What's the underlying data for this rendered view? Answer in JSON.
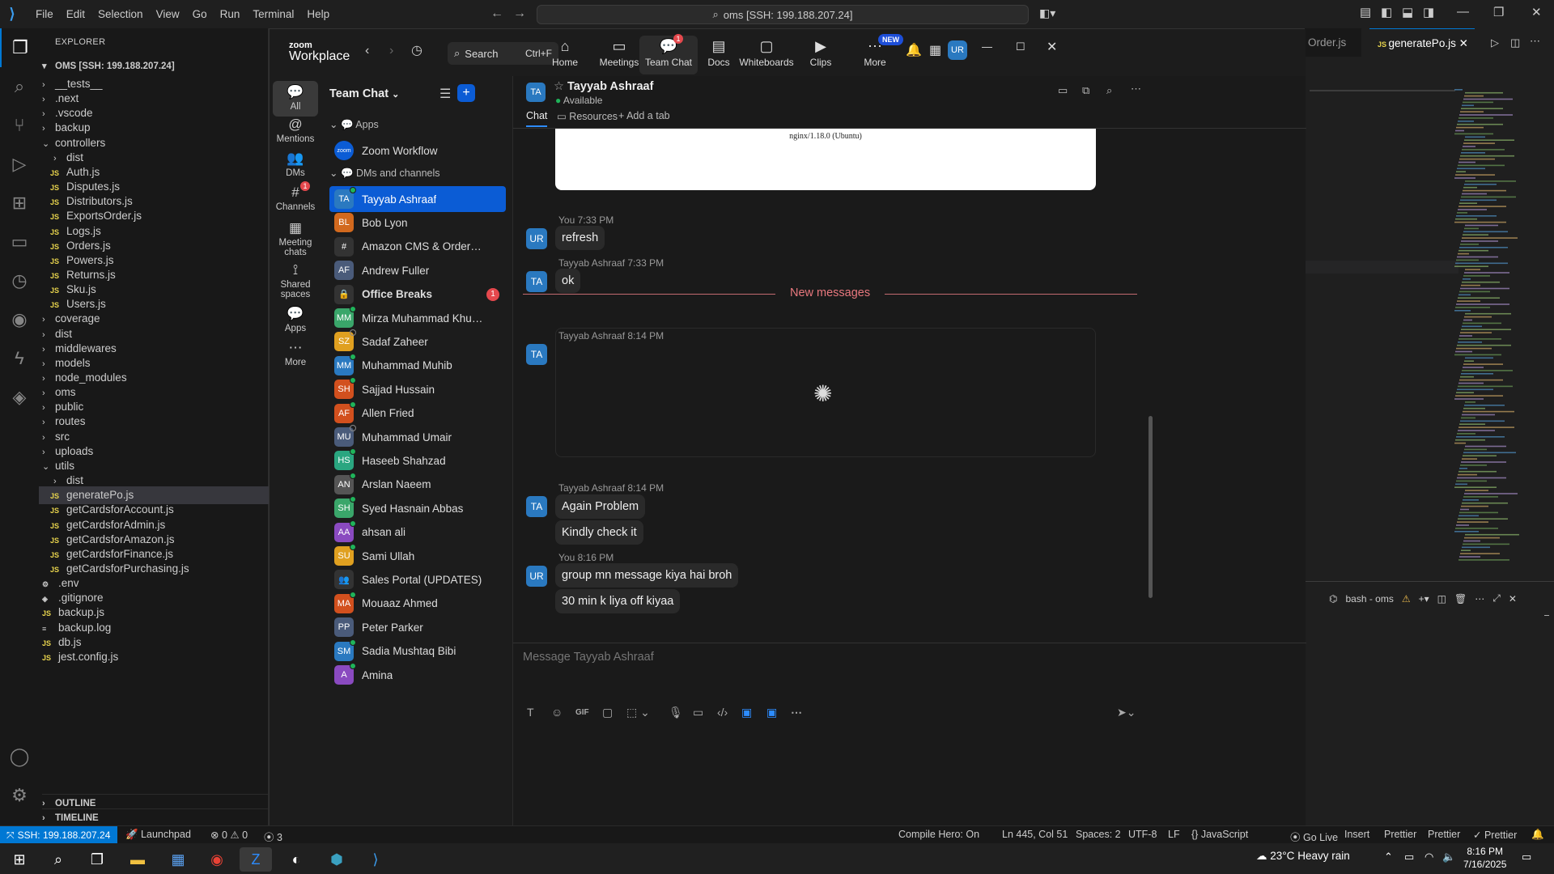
{
  "vscode": {
    "menu": [
      "File",
      "Edit",
      "Selection",
      "View",
      "Go",
      "Run",
      "Terminal",
      "Help"
    ],
    "search": "oms [SSH: 199.188.207.24]",
    "explorer_title": "EXPLORER",
    "root": "OMS [SSH: 199.188.207.24]",
    "tree": [
      {
        "label": "__tests__",
        "type": "folder",
        "open": false,
        "depth": 1
      },
      {
        "label": ".next",
        "type": "folder",
        "open": false,
        "depth": 1
      },
      {
        "label": ".vscode",
        "type": "folder",
        "open": false,
        "depth": 1
      },
      {
        "label": "backup",
        "type": "folder",
        "open": false,
        "depth": 1
      },
      {
        "label": "controllers",
        "type": "folder",
        "open": true,
        "depth": 1
      },
      {
        "label": "dist",
        "type": "folder",
        "open": false,
        "depth": 2
      },
      {
        "label": "Auth.js",
        "type": "js",
        "depth": 2
      },
      {
        "label": "Disputes.js",
        "type": "js",
        "depth": 2
      },
      {
        "label": "Distributors.js",
        "type": "js",
        "depth": 2
      },
      {
        "label": "ExportsOrder.js",
        "type": "js",
        "depth": 2
      },
      {
        "label": "Logs.js",
        "type": "js",
        "depth": 2
      },
      {
        "label": "Orders.js",
        "type": "js",
        "depth": 2
      },
      {
        "label": "Powers.js",
        "type": "js",
        "depth": 2
      },
      {
        "label": "Returns.js",
        "type": "js",
        "depth": 2
      },
      {
        "label": "Sku.js",
        "type": "js",
        "depth": 2
      },
      {
        "label": "Users.js",
        "type": "js",
        "depth": 2
      },
      {
        "label": "coverage",
        "type": "folder",
        "open": false,
        "depth": 1
      },
      {
        "label": "dist",
        "type": "folder",
        "open": false,
        "depth": 1
      },
      {
        "label": "middlewares",
        "type": "folder",
        "open": false,
        "depth": 1
      },
      {
        "label": "models",
        "type": "folder",
        "open": false,
        "depth": 1
      },
      {
        "label": "node_modules",
        "type": "folder",
        "open": false,
        "depth": 1
      },
      {
        "label": "oms",
        "type": "folder",
        "open": false,
        "depth": 1
      },
      {
        "label": "public",
        "type": "folder",
        "open": false,
        "depth": 1
      },
      {
        "label": "routes",
        "type": "folder",
        "open": false,
        "depth": 1
      },
      {
        "label": "src",
        "type": "folder",
        "open": false,
        "depth": 1
      },
      {
        "label": "uploads",
        "type": "folder",
        "open": false,
        "depth": 1
      },
      {
        "label": "utils",
        "type": "folder",
        "open": true,
        "depth": 1
      },
      {
        "label": "dist",
        "type": "folder",
        "open": false,
        "depth": 2
      },
      {
        "label": "generatePo.js",
        "type": "js",
        "depth": 2,
        "selected": true
      },
      {
        "label": "getCardsforAccount.js",
        "type": "js",
        "depth": 2
      },
      {
        "label": "getCardsforAdmin.js",
        "type": "js",
        "depth": 2
      },
      {
        "label": "getCardsforAmazon.js",
        "type": "js",
        "depth": 2
      },
      {
        "label": "getCardsforFinance.js",
        "type": "js",
        "depth": 2
      },
      {
        "label": "getCardsforPurchasing.js",
        "type": "js",
        "depth": 2
      },
      {
        "label": ".env",
        "type": "gear",
        "depth": 1
      },
      {
        "label": ".gitignore",
        "type": "git",
        "depth": 1
      },
      {
        "label": "backup.js",
        "type": "js",
        "depth": 1
      },
      {
        "label": "backup.log",
        "type": "log",
        "depth": 1
      },
      {
        "label": "db.js",
        "type": "js",
        "depth": 1
      },
      {
        "label": "jest.config.js",
        "type": "js",
        "depth": 1
      }
    ],
    "outline": "OUTLINE",
    "timeline": "TIMELINE",
    "tabs": [
      "Order.js",
      "generatePo.js"
    ],
    "terminal": "bash - oms",
    "status": {
      "remote": "SSH: 199.188.207.24",
      "launchpad": "Launchpad",
      "problems": "0",
      "warnings": "0",
      "ports": "3",
      "compile": "Compile Hero: On",
      "position": "Ln 445, Col 51",
      "spaces": "Spaces: 2",
      "encoding": "UTF-8",
      "eol": "LF",
      "language": "JavaScript",
      "golive": "Go Live",
      "insert": "Insert",
      "prettier1": "Prettier",
      "prettier2": "Prettier",
      "prettier3": "Prettier"
    }
  },
  "zoom": {
    "logo_top": "zoom",
    "logo_bottom": "Workplace",
    "search": "Search",
    "search_shortcut": "Ctrl+F",
    "nav": [
      {
        "label": "Home",
        "icon": "home-icon"
      },
      {
        "label": "Meetings",
        "icon": "video-icon"
      },
      {
        "label": "Team Chat",
        "icon": "chat-icon",
        "badge": "1",
        "active": true
      },
      {
        "label": "Docs",
        "icon": "doc-icon"
      },
      {
        "label": "Whiteboards",
        "icon": "whiteboard-icon"
      },
      {
        "label": "Clips",
        "icon": "clips-icon"
      },
      {
        "label": "More",
        "icon": "more-icon",
        "badge": "NEW"
      }
    ],
    "avatar": "UR",
    "rail": [
      {
        "label": "All",
        "icon": "chat-icon"
      },
      {
        "label": "Mentions",
        "icon": "at-icon"
      },
      {
        "label": "DMs",
        "icon": "people-icon"
      },
      {
        "label": "Channels",
        "icon": "hash-icon",
        "badge": "1"
      },
      {
        "label": "Meeting chats",
        "icon": "calendar-icon"
      },
      {
        "label": "Shared spaces",
        "icon": "share-icon"
      },
      {
        "label": "Apps",
        "icon": "apps-icon"
      },
      {
        "label": "More",
        "icon": "more-icon"
      }
    ],
    "list_title": "Team Chat",
    "sections": {
      "apps": "Apps",
      "dms": "DMs and channels"
    },
    "apps": [
      {
        "name": "Zoom Workflow",
        "initials": "zoom",
        "color": "#0b5cd5"
      }
    ],
    "chats": [
      {
        "name": "Tayyab Ashraaf",
        "initials": "TA",
        "color": "#2a79c0",
        "selected": true,
        "status": "on"
      },
      {
        "name": "Bob Lyon",
        "initials": "BL",
        "color": "#d2691e",
        "status": "none"
      },
      {
        "name": "Amazon CMS & OrderAuto...",
        "initials": "#",
        "color": "#333",
        "status": "none"
      },
      {
        "name": "Andrew Fuller",
        "initials": "AF",
        "color": "#4a5b7a",
        "status": "none"
      },
      {
        "name": "Office Breaks",
        "initials": "🔒",
        "color": "#333",
        "bold": true,
        "badge": "1",
        "status": "none"
      },
      {
        "name": "Mirza Muhammad Khurram",
        "initials": "MM",
        "color": "#3aa66a",
        "status": "on"
      },
      {
        "name": "Sadaf Zaheer",
        "initials": "SZ",
        "color": "#e0a020",
        "status": "off"
      },
      {
        "name": "Muhammad Muhib",
        "initials": "MM",
        "color": "#2a79c0",
        "status": "on"
      },
      {
        "name": "Sajjad Hussain",
        "initials": "SH",
        "color": "#d2501e",
        "status": "on"
      },
      {
        "name": "Allen Fried",
        "initials": "AF",
        "color": "#d2501e",
        "status": "on"
      },
      {
        "name": "Muhammad Umair",
        "initials": "MU",
        "color": "#4a5b7a",
        "status": "off"
      },
      {
        "name": "Haseeb Shahzad",
        "initials": "HS",
        "color": "#2aa680",
        "status": "on"
      },
      {
        "name": "Arslan Naeem",
        "initials": "AN",
        "color": "#555",
        "status": "on"
      },
      {
        "name": "Syed Hasnain Abbas",
        "initials": "SH",
        "color": "#3aa66a",
        "status": "on"
      },
      {
        "name": "ahsan ali",
        "initials": "AA",
        "color": "#8a4ac0",
        "status": "on"
      },
      {
        "name": "Sami Ullah",
        "initials": "SU",
        "color": "#e0a020",
        "status": "on"
      },
      {
        "name": "Sales Portal (UPDATES)",
        "initials": "👥",
        "color": "#333",
        "status": "none"
      },
      {
        "name": "Mouaaz Ahmed",
        "initials": "MA",
        "color": "#d2501e",
        "status": "on"
      },
      {
        "name": "Peter Parker",
        "initials": "PP",
        "color": "#4a5b7a",
        "status": "none"
      },
      {
        "name": "Sadia Mushtaq Bibi",
        "initials": "SM",
        "color": "#2a79c0",
        "status": "on"
      },
      {
        "name": "Amina",
        "initials": "A",
        "color": "#8a4ac0",
        "status": "on"
      }
    ],
    "conversation": {
      "name": "Tayyab Ashraaf",
      "initials": "TA",
      "presence": "Available",
      "tabs": [
        "Chat",
        "Resources",
        "Add a tab"
      ],
      "preview_text": "nginx/1.18.0 (Ubuntu)",
      "new_messages": "New messages",
      "messages": [
        {
          "meta": "You 7:33 PM",
          "initials": "UR",
          "texts": [
            "refresh"
          ]
        },
        {
          "meta": "Tayyab Ashraaf 7:33 PM",
          "initials": "TA",
          "texts": [
            "ok"
          ]
        },
        {
          "meta": "Tayyab Ashraaf 8:14 PM",
          "initials": "TA",
          "texts": []
        },
        {
          "meta": "Tayyab Ashraaf 8:14 PM",
          "initials": "TA",
          "texts": [
            "Again Problem",
            "Kindly check it"
          ]
        },
        {
          "meta": "You 8:16 PM",
          "initials": "UR",
          "texts": [
            "group mn message kiya hai broh",
            "30 min k liya off kiyaa"
          ]
        }
      ],
      "composer_placeholder": "Message Tayyab Ashraaf"
    }
  },
  "taskbar": {
    "weather_temp": "23°C",
    "weather_text": "Heavy rain",
    "time": "8:16 PM",
    "date": "7/16/2025"
  }
}
